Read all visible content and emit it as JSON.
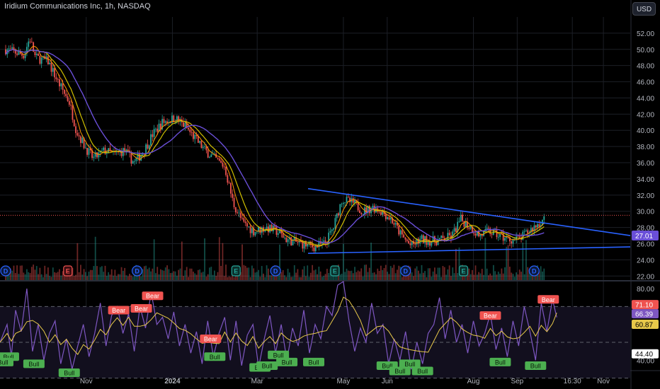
{
  "header": {
    "title": "Iridium Communications Inc, 1h, NASDAQ",
    "currency_button": "USD"
  },
  "colors": {
    "background": "#000000",
    "grid": "#1c1f26",
    "axis_text": "#b2b5be",
    "candle_up": "#26a69a",
    "candle_down": "#ef5350",
    "ma_fast": "#ff9800",
    "ma_mid": "#d0c000",
    "ma_slow": "#6a4fd8",
    "trendline": "#2962ff",
    "rsi_line": "#7e57c2",
    "rsi_ma": "#e8c94a",
    "label_bull": "#4caf50",
    "label_bear": "#f05350",
    "event_dividend": "#2962ff",
    "event_earnings_e": "#26a69a",
    "event_earnings_red": "#ef5350"
  },
  "chart_data": [
    {
      "type": "candlestick",
      "title": "Iridium Communications Inc, 1h, NASDAQ",
      "y_ticks": [
        52,
        50,
        48,
        46,
        44,
        42,
        40,
        38,
        36,
        34,
        32,
        30,
        28,
        26,
        24,
        22
      ],
      "y_tick_labels": [
        "52.00",
        "50.00",
        "48.00",
        "46.00",
        "44.00",
        "42.00",
        "40.00",
        "38.00",
        "36.00",
        "34.00",
        "32.00",
        "30.00",
        "28.00",
        "26.00",
        "24.00",
        "22.00"
      ],
      "ylim": [
        21.5,
        54
      ],
      "x_labels": [
        "Nov",
        "2024",
        "Mar",
        "May",
        "Jun",
        "Aug",
        "Sep",
        "16:30",
        "Nov"
      ],
      "x_label_dates": [
        "2023-11-01",
        "2024-01-01",
        "2024-03-01",
        "2024-05-01",
        "2024-06-01",
        "2024-08-01",
        "2024-09-01",
        "2024-10-10",
        "2024-11-01"
      ],
      "xlim": [
        "2023-09-01",
        "2024-11-20"
      ],
      "price_path": [
        [
          "2023-09-05",
          50.0
        ],
        [
          "2023-09-18",
          49.3
        ],
        [
          "2023-09-22",
          51.4
        ],
        [
          "2023-09-26",
          49.0
        ],
        [
          "2023-10-05",
          48.5
        ],
        [
          "2023-10-12",
          46.0
        ],
        [
          "2023-10-20",
          43.5
        ],
        [
          "2023-10-25",
          40.0
        ],
        [
          "2023-10-31",
          38.0
        ],
        [
          "2023-11-06",
          36.5
        ],
        [
          "2023-11-14",
          37.5
        ],
        [
          "2023-11-21",
          37.0
        ],
        [
          "2023-11-28",
          37.5
        ],
        [
          "2023-12-05",
          36.0
        ],
        [
          "2023-12-12",
          37.5
        ],
        [
          "2023-12-18",
          39.5
        ],
        [
          "2023-12-25",
          41.0
        ],
        [
          "2024-01-03",
          41.5
        ],
        [
          "2024-01-10",
          40.5
        ],
        [
          "2024-01-17",
          39.0
        ],
        [
          "2024-01-24",
          37.5
        ],
        [
          "2024-01-31",
          36.5
        ],
        [
          "2024-02-07",
          35.5
        ],
        [
          "2024-02-13",
          31.0
        ],
        [
          "2024-02-20",
          28.5
        ],
        [
          "2024-02-28",
          27.5
        ],
        [
          "2024-03-07",
          28.0
        ],
        [
          "2024-03-15",
          27.5
        ],
        [
          "2024-03-22",
          26.5
        ],
        [
          "2024-04-01",
          26.0
        ],
        [
          "2024-04-10",
          25.6
        ],
        [
          "2024-04-18",
          26.0
        ],
        [
          "2024-04-24",
          28.0
        ],
        [
          "2024-04-30",
          31.5
        ],
        [
          "2024-05-08",
          31.0
        ],
        [
          "2024-05-15",
          30.0
        ],
        [
          "2024-05-22",
          30.5
        ],
        [
          "2024-05-28",
          30.0
        ],
        [
          "2024-06-04",
          29.0
        ],
        [
          "2024-06-11",
          27.0
        ],
        [
          "2024-06-18",
          25.7
        ],
        [
          "2024-06-25",
          26.5
        ],
        [
          "2024-07-03",
          26.3
        ],
        [
          "2024-07-10",
          26.5
        ],
        [
          "2024-07-17",
          27.0
        ],
        [
          "2024-07-23",
          29.0
        ],
        [
          "2024-07-30",
          28.0
        ],
        [
          "2024-08-05",
          27.0
        ],
        [
          "2024-08-12",
          27.5
        ],
        [
          "2024-08-19",
          27.0
        ],
        [
          "2024-08-26",
          26.5
        ],
        [
          "2024-09-02",
          26.5
        ],
        [
          "2024-09-09",
          27.5
        ],
        [
          "2024-09-16",
          28.5
        ],
        [
          "2024-09-20",
          29.0
        ]
      ],
      "last_price": 29.5,
      "price_labels": [
        {
          "text": "27.01",
          "color": "#6a4fd8"
        }
      ],
      "trendlines": [
        {
          "from": [
            "2024-04-06",
            32.8
          ],
          "to": [
            "2024-11-20",
            27.0
          ]
        },
        {
          "from": [
            "2024-04-06",
            24.8
          ],
          "to": [
            "2024-11-20",
            25.6
          ]
        }
      ],
      "events": [
        {
          "date": "2023-09-05",
          "letter": "D",
          "kind": "dividend"
        },
        {
          "date": "2023-10-19",
          "letter": "E",
          "kind": "earnings_red"
        },
        {
          "date": "2023-12-07",
          "letter": "D",
          "kind": "dividend"
        },
        {
          "date": "2024-02-15",
          "letter": "E",
          "kind": "earnings_e"
        },
        {
          "date": "2024-03-14",
          "letter": "D",
          "kind": "dividend"
        },
        {
          "date": "2024-04-25",
          "letter": "E",
          "kind": "earnings_e"
        },
        {
          "date": "2024-06-14",
          "letter": "D",
          "kind": "dividend"
        },
        {
          "date": "2024-07-25",
          "letter": "E",
          "kind": "earnings_e"
        },
        {
          "date": "2024-09-13",
          "letter": "D",
          "kind": "dividend"
        }
      ]
    },
    {
      "type": "line",
      "title": "RSI",
      "y_ticks": [
        80,
        40
      ],
      "y_tick_labels": [
        "80.00",
        "40.00"
      ],
      "ylim": [
        35,
        84
      ],
      "levels": [
        70,
        50,
        30
      ],
      "value_labels": [
        {
          "text": "71.10",
          "color": "#f05350"
        },
        {
          "text": "66.39",
          "color": "#7e57c2"
        },
        {
          "text": "60.87",
          "color": "#e8c94a"
        },
        {
          "text": "44.40",
          "color": "#ffffff"
        }
      ],
      "signals": [
        {
          "date": "2023-09-07",
          "text": "Bull",
          "value": 42,
          "kind": "bull"
        },
        {
          "date": "2023-09-03",
          "text": "Bull",
          "value": 39,
          "kind": "bull"
        },
        {
          "date": "2023-09-25",
          "text": "Bull",
          "value": 38,
          "kind": "bull"
        },
        {
          "date": "2023-10-20",
          "text": "Bull",
          "value": 33,
          "kind": "bull"
        },
        {
          "date": "2023-11-24",
          "text": "Bear",
          "value": 68,
          "kind": "bear"
        },
        {
          "date": "2023-12-10",
          "text": "Bear",
          "value": 69,
          "kind": "bear"
        },
        {
          "date": "2023-12-18",
          "text": "Bear",
          "value": 76,
          "kind": "bear"
        },
        {
          "date": "2024-01-28",
          "text": "Bear",
          "value": 52,
          "kind": "bear"
        },
        {
          "date": "2024-01-31",
          "text": "Bull",
          "value": 42,
          "kind": "bull"
        },
        {
          "date": "2024-03-03",
          "text": "Bull",
          "value": 36,
          "kind": "bull"
        },
        {
          "date": "2024-03-08",
          "text": "Bull",
          "value": 37,
          "kind": "bull"
        },
        {
          "date": "2024-03-16",
          "text": "Bull",
          "value": 43,
          "kind": "bull"
        },
        {
          "date": "2024-03-22",
          "text": "Bull",
          "value": 39,
          "kind": "bull"
        },
        {
          "date": "2024-04-10",
          "text": "Bull",
          "value": 39,
          "kind": "bull"
        },
        {
          "date": "2024-06-01",
          "text": "Bull",
          "value": 37,
          "kind": "bull"
        },
        {
          "date": "2024-06-10",
          "text": "Bull",
          "value": 34,
          "kind": "bull"
        },
        {
          "date": "2024-06-17",
          "text": "Bull",
          "value": 38,
          "kind": "bull"
        },
        {
          "date": "2024-06-26",
          "text": "Bull",
          "value": 34,
          "kind": "bull"
        },
        {
          "date": "2024-08-20",
          "text": "Bull",
          "value": 39,
          "kind": "bull"
        },
        {
          "date": "2024-08-13",
          "text": "Bear",
          "value": 65,
          "kind": "bear"
        },
        {
          "date": "2024-09-14",
          "text": "Bull",
          "value": 37,
          "kind": "bull"
        },
        {
          "date": "2024-09-23",
          "text": "Bear",
          "value": 74,
          "kind": "bear"
        }
      ],
      "rsi_path": [
        [
          "2023-09-01",
          50
        ],
        [
          "2023-09-06",
          60
        ],
        [
          "2023-09-09",
          42
        ],
        [
          "2023-09-12",
          68
        ],
        [
          "2023-09-16",
          56
        ],
        [
          "2023-09-20",
          80
        ],
        [
          "2023-09-24",
          45
        ],
        [
          "2023-09-28",
          60
        ],
        [
          "2023-10-02",
          40
        ],
        [
          "2023-10-06",
          55
        ],
        [
          "2023-10-10",
          62
        ],
        [
          "2023-10-14",
          38
        ],
        [
          "2023-10-18",
          52
        ],
        [
          "2023-10-22",
          35
        ],
        [
          "2023-10-26",
          48
        ],
        [
          "2023-10-30",
          60
        ],
        [
          "2023-11-03",
          42
        ],
        [
          "2023-11-07",
          55
        ],
        [
          "2023-11-11",
          72
        ],
        [
          "2023-11-15",
          48
        ],
        [
          "2023-11-19",
          65
        ],
        [
          "2023-11-23",
          70
        ],
        [
          "2023-11-27",
          55
        ],
        [
          "2023-12-01",
          66
        ],
        [
          "2023-12-05",
          45
        ],
        [
          "2023-12-09",
          70
        ],
        [
          "2023-12-13",
          58
        ],
        [
          "2023-12-17",
          78
        ],
        [
          "2023-12-21",
          60
        ],
        [
          "2023-12-25",
          64
        ],
        [
          "2023-12-29",
          52
        ],
        [
          "2024-01-02",
          67
        ],
        [
          "2024-01-06",
          48
        ],
        [
          "2024-01-10",
          60
        ],
        [
          "2024-01-14",
          44
        ],
        [
          "2024-01-18",
          56
        ],
        [
          "2024-01-22",
          38
        ],
        [
          "2024-01-26",
          62
        ],
        [
          "2024-01-30",
          42
        ],
        [
          "2024-02-03",
          55
        ],
        [
          "2024-02-07",
          64
        ],
        [
          "2024-02-11",
          40
        ],
        [
          "2024-02-15",
          62
        ],
        [
          "2024-02-19",
          37
        ],
        [
          "2024-02-23",
          54
        ],
        [
          "2024-02-27",
          60
        ],
        [
          "2024-03-02",
          36
        ],
        [
          "2024-03-06",
          52
        ],
        [
          "2024-03-10",
          65
        ],
        [
          "2024-03-14",
          44
        ],
        [
          "2024-03-18",
          60
        ],
        [
          "2024-03-22",
          40
        ],
        [
          "2024-03-26",
          58
        ],
        [
          "2024-03-30",
          48
        ],
        [
          "2024-04-03",
          68
        ],
        [
          "2024-04-07",
          44
        ],
        [
          "2024-04-11",
          60
        ],
        [
          "2024-04-15",
          52
        ],
        [
          "2024-04-19",
          70
        ],
        [
          "2024-04-23",
          65
        ],
        [
          "2024-04-27",
          82
        ],
        [
          "2024-05-01",
          84
        ],
        [
          "2024-05-05",
          62
        ],
        [
          "2024-05-09",
          45
        ],
        [
          "2024-05-13",
          58
        ],
        [
          "2024-05-17",
          50
        ],
        [
          "2024-05-21",
          72
        ],
        [
          "2024-05-25",
          55
        ],
        [
          "2024-05-29",
          60
        ],
        [
          "2024-06-02",
          38
        ],
        [
          "2024-06-06",
          52
        ],
        [
          "2024-06-10",
          40
        ],
        [
          "2024-06-14",
          56
        ],
        [
          "2024-06-18",
          35
        ],
        [
          "2024-06-22",
          50
        ],
        [
          "2024-06-26",
          38
        ],
        [
          "2024-06-30",
          55
        ],
        [
          "2024-07-04",
          60
        ],
        [
          "2024-07-08",
          75
        ],
        [
          "2024-07-12",
          52
        ],
        [
          "2024-07-16",
          68
        ],
        [
          "2024-07-20",
          50
        ],
        [
          "2024-07-24",
          60
        ],
        [
          "2024-07-28",
          44
        ],
        [
          "2024-08-01",
          62
        ],
        [
          "2024-08-05",
          48
        ],
        [
          "2024-08-09",
          55
        ],
        [
          "2024-08-13",
          66
        ],
        [
          "2024-08-17",
          46
        ],
        [
          "2024-08-21",
          58
        ],
        [
          "2024-08-25",
          42
        ],
        [
          "2024-08-29",
          62
        ],
        [
          "2024-09-02",
          48
        ],
        [
          "2024-09-06",
          70
        ],
        [
          "2024-09-10",
          56
        ],
        [
          "2024-09-14",
          40
        ],
        [
          "2024-09-18",
          72
        ],
        [
          "2024-09-22",
          56
        ],
        [
          "2024-09-26",
          74
        ],
        [
          "2024-09-29",
          64
        ]
      ]
    }
  ]
}
